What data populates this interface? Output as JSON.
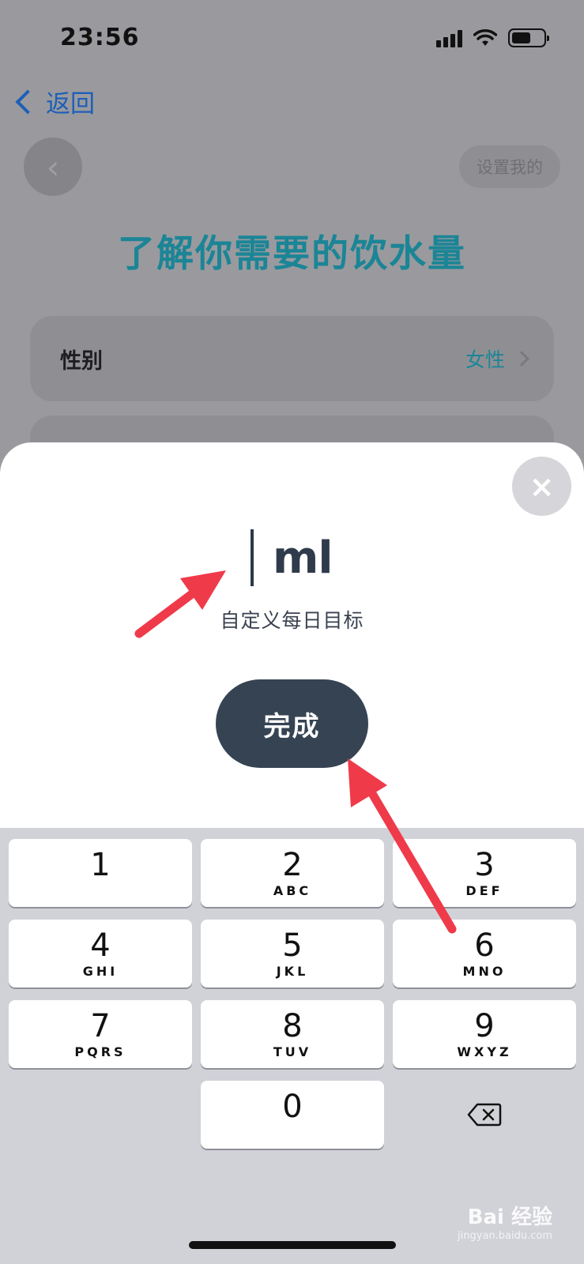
{
  "status_bar": {
    "time": "23:56"
  },
  "nav": {
    "back_label": "返回"
  },
  "page": {
    "circle_back_glyph": "‹",
    "set_mine_label": "设置我的",
    "title": "了解你需要的饮水量",
    "gender_row": {
      "label": "性别",
      "value": "女性"
    }
  },
  "sheet": {
    "close_glyph": "×",
    "unit": "ml",
    "input_value": "",
    "sub_label": "自定义每日目标",
    "done_label": "完成"
  },
  "keypad": {
    "keys": [
      {
        "num": "1",
        "letters": ""
      },
      {
        "num": "2",
        "letters": "ABC"
      },
      {
        "num": "3",
        "letters": "DEF"
      },
      {
        "num": "4",
        "letters": "GHI"
      },
      {
        "num": "5",
        "letters": "JKL"
      },
      {
        "num": "6",
        "letters": "MNO"
      },
      {
        "num": "7",
        "letters": "PQRS"
      },
      {
        "num": "8",
        "letters": "TUV"
      },
      {
        "num": "9",
        "letters": "WXYZ"
      },
      {
        "num": "0",
        "letters": ""
      }
    ],
    "delete_icon": "delete-backspace-icon"
  },
  "watermark": {
    "brand": "Bai 经验",
    "url": "jingyan.baidu.com"
  },
  "colors": {
    "accent_teal": "#1b8596",
    "link_blue": "#1d5fb8",
    "done_button": "#364353",
    "annotation_red": "#ef3a4a"
  }
}
